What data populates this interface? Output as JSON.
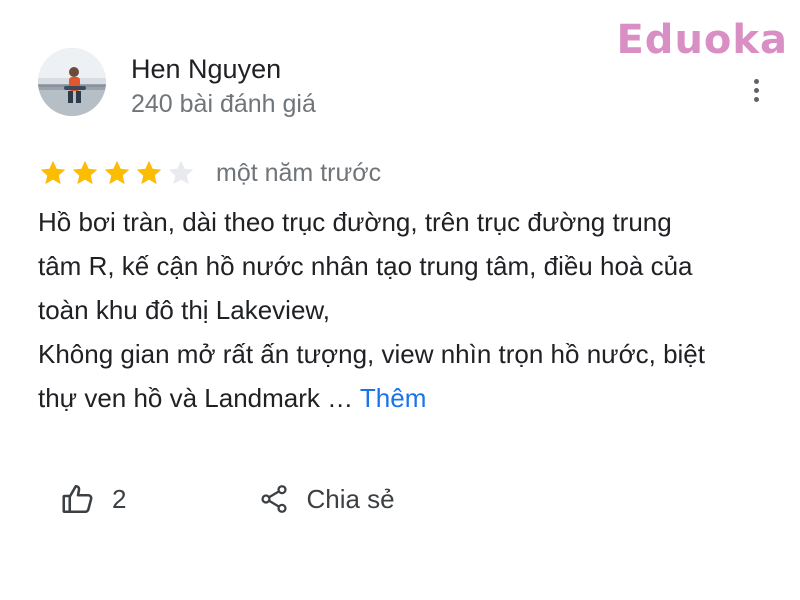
{
  "watermark": {
    "text": "Eduoka",
    "color": "#d98fc4"
  },
  "author": {
    "name": "Hen Nguyen",
    "meta": "240 bài đánh giá"
  },
  "menu": {
    "icon": "more-vert-icon"
  },
  "review": {
    "rating": 4,
    "max_rating": 5,
    "star_color": "#fbbc04",
    "time": "một năm trước",
    "lines": [
      "Hồ bơi tràn, dài theo trục đường, trên trục đường trung",
      "tâm R, kế cận hồ nước nhân tạo trung tâm, điều hoà của",
      "toàn khu đô thị Lakeview,",
      "Không gian mở rất ấn tượng, view nhìn trọn hồ nước, biệt",
      "thự ven hồ và Landmark …"
    ],
    "more_label": "Thêm",
    "link_color": "#1a73e8"
  },
  "actions": {
    "like_count": "2",
    "share_label": "Chia sẻ"
  }
}
